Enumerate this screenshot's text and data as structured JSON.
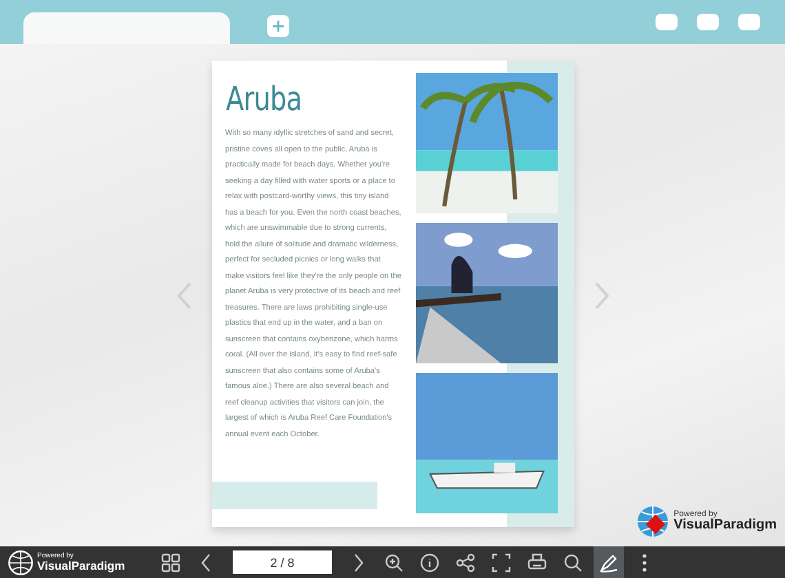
{
  "page": {
    "title": "Aruba",
    "body": "With so many idyllic stretches of sand and secret, pristine coves all open to the public, Aruba is practically made for beach days. Whether you're seeking a day filled with water sports or a place to relax with postcard-worthy views, this tiny island has a beach for you. Even the north coast beaches, which are unswimmable due to strong currents, hold the allure of solitude and dramatic wilderness, perfect for secluded picnics or long walks that make visitors feel like they're the only people on the planet Aruba is very protective of its beach and reef treasures. There are laws prohibiting single-use plastics that end up in the water, and a ban on sunscreen that contains oxybenzone, which harms coral. (All over the island, it's easy to find reef-safe sunscreen that also contains some of Aruba's famous aloe.) There are also several beach and reef cleanup activities that visitors can join, the largest of which is Aruba Reef Care Foundation's annual event each October."
  },
  "badge": {
    "caption": "Powered by",
    "brand": "VisualParadigm"
  },
  "toolbar": {
    "logo": {
      "caption": "Powered by",
      "brand": "VisualParadigm"
    },
    "page_indicator": "2 / 8",
    "tools": [
      {
        "kind": "thumbnails",
        "selected": false
      },
      {
        "kind": "prev",
        "selected": false
      },
      {
        "kind": "pager"
      },
      {
        "kind": "next",
        "selected": false
      },
      {
        "kind": "zoom",
        "selected": false
      },
      {
        "kind": "info",
        "selected": false
      },
      {
        "kind": "share",
        "selected": false
      },
      {
        "kind": "fullscreen",
        "selected": false
      },
      {
        "kind": "print",
        "selected": false
      },
      {
        "kind": "search",
        "selected": false
      },
      {
        "kind": "annotate",
        "selected": true
      },
      {
        "kind": "more",
        "selected": false
      }
    ]
  }
}
